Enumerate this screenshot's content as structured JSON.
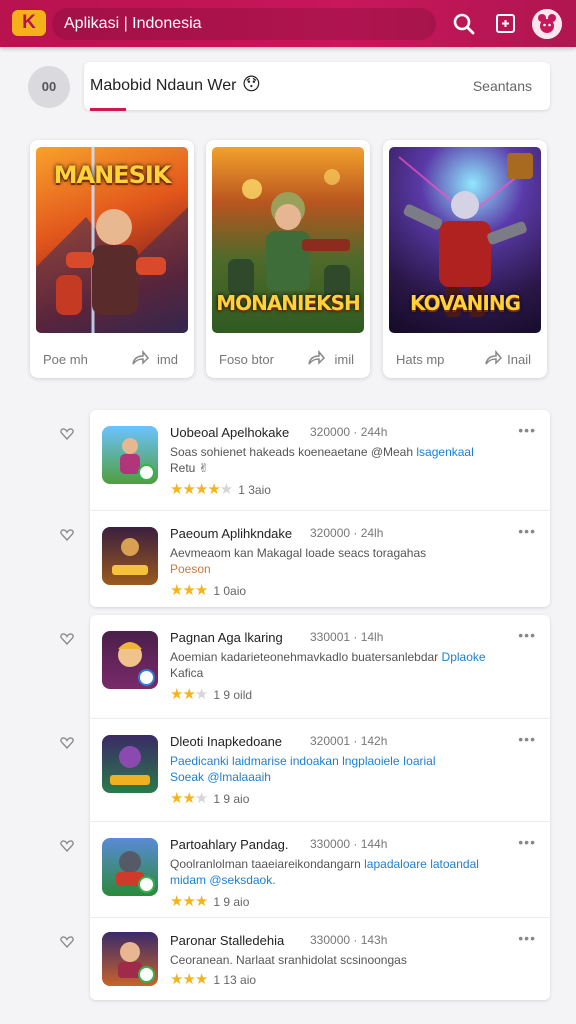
{
  "colors": {
    "accent": "#c8175a",
    "star": "#f3b51a",
    "link": "#1d7fd1"
  },
  "topbar": {
    "logo_text": "K",
    "title": "Aplikasi | Indonesia",
    "icons": [
      "search-icon",
      "square-icon",
      "avatar-icon"
    ]
  },
  "header": {
    "avatar_text": "00",
    "name": "Mabobid Ndaun Wer",
    "emoji": "😯",
    "right_label": "Seantans"
  },
  "cards": [
    {
      "title": "MANESIK",
      "footer_left": "Poe mh",
      "footer_right": "imd"
    },
    {
      "title": "MONANIEKSH",
      "footer_left": "Foso btor",
      "footer_right": "imil"
    },
    {
      "title": "KOVANING",
      "footer_left": "Hats mp",
      "footer_right": "Inail"
    }
  ],
  "list": [
    {
      "name": "Uobeoal Apelhokake",
      "meta": "320000 · 244h",
      "desc": "Soas sohienet hakeads koeneaetane @Meah",
      "desc_link": "lsagenkaal",
      "sub": "Retu ✌",
      "sub_is_link": false,
      "rating": 4,
      "count": "1 3aio"
    },
    {
      "name": "Paeoum Aplihkndake",
      "meta": "320000 · 24lh",
      "desc": "Aevmeaom kan Makagal loade seacs toragahas",
      "desc_link": "",
      "sub": "Poeson",
      "sub_is_link": false,
      "rating": 3,
      "count": "1 0aio"
    },
    {
      "name": "Pagnan Aga lkaring",
      "meta": "330001 · 14lh",
      "desc": "Aoemian kadarieteonehmavkadlo buatersanlebdar",
      "desc_link": "Dplaoke",
      "sub": "Kafica",
      "sub_is_link": false,
      "rating": 2,
      "count": "1 9 oild"
    },
    {
      "name": "Dleoti Inapkedoane",
      "meta": "320001 · 142h",
      "desc": "Paedicanki laidmarise indoakan",
      "desc_link": "lngplaoiele Ioarial",
      "sub": "Soeak @lmalaaaih",
      "sub_is_link": true,
      "rating": 2,
      "count": "1 9 aio"
    },
    {
      "name": "Partoahlary Pandag.",
      "meta": "330000 · 144h",
      "desc": "Qoolranlolman taaeiareikondangarn",
      "desc_link": "lapadaloare latoandal",
      "sub": "midam @seksdaok.",
      "sub_is_link": true,
      "rating": 3,
      "count": "1 9 aio"
    },
    {
      "name": "Paronar Stalledehia",
      "meta": "330000 · 143h",
      "desc": "Ceoranean. Narlaat sranhidolat scsinoongas",
      "desc_link": "",
      "sub": "",
      "sub_is_link": false,
      "rating": 3,
      "count": "1 13 aio"
    }
  ]
}
